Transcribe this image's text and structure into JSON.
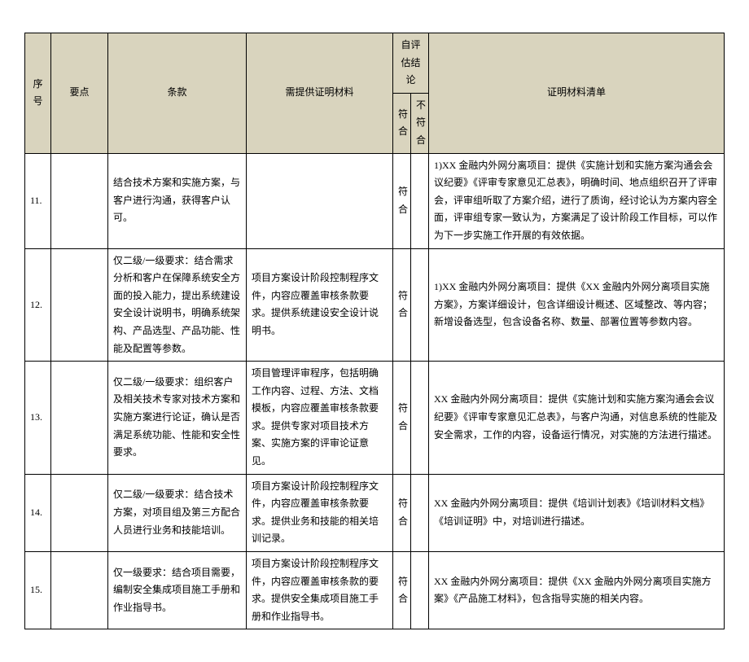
{
  "headers": {
    "no": "序号",
    "point": "要点",
    "clause": "条款",
    "material": "需提供证明材料",
    "self_eval": "自评估结论",
    "conform": "符合",
    "nonconform": "不符合",
    "list": "证明材料清单"
  },
  "rows": [
    {
      "no": "11.",
      "point": "",
      "clause": "结合技术方案和实施方案，与客户进行沟通，获得客户认可。",
      "material": "",
      "conform": "符合",
      "nonconform": "",
      "list": "1)XX 金融内外网分离项目：提供《实施计划和实施方案沟通会会议纪要》《评审专家意见汇总表》，明确时间、地点组织召开了评审会，评审组听取了方案介绍，进行了质询，经讨论认为方案内容全面，评审组专家一致认为，方案满足了设计阶段工作目标，可以作为下一步实施工作开展的有效依据。"
    },
    {
      "no": "12.",
      "point": "",
      "clause": "仅二级/一级要求：结合需求分析和客户在保障系统安全方面的投入能力，提出系统建设安全设计说明书，明确系统架构、产品选型、产品功能、性能及配置等参数。",
      "material": "项目方案设计阶段控制程序文件，内容应覆盖审核条款要求。提供系统建设安全设计说明书。",
      "conform": "符合",
      "nonconform": "",
      "list": "1)XX 金融内外网分离项目：提供《XX 金融内外网分离项目实施方案》，方案详细设计，包含详细设计概述、区域整改、等内容；新增设备选型，包含设备名称、数量、部署位置等参数内容。"
    },
    {
      "no": "13.",
      "point": "",
      "clause": "仅二级/一级要求：组织客户及相关技术专家对技术方案和实施方案进行论证，确认是否满足系统功能、性能和安全性要求。",
      "material": "项目管理评审程序，包括明确工作内容、过程、方法、文档模板，内容应覆盖审核条款要求。提供专家对项目技术方案、实施方案的评审论证意见。",
      "conform": "符合",
      "nonconform": "",
      "list": "XX 金融内外网分离项目：提供《实施计划和实施方案沟通会会议纪要》《评审专家意见汇总表》，与客户沟通，对信息系统的性能及安全需求，工作的内容，设备运行情况，对实施的方法进行描述。"
    },
    {
      "no": "14.",
      "point": "",
      "clause": "仅二级/一级要求：结合技术方案，对项目组及第三方配合人员进行业务和技能培训。",
      "material": "项目方案设计阶段控制程序文件，内容应覆盖审核条款要求。提供业务和技能的相关培训记录。",
      "conform": "符合",
      "nonconform": "",
      "list": "XX 金融内外网分离项目：提供《培训计划表》《培训材料文档》《培训证明》中，对培训进行描述。"
    },
    {
      "no": "15.",
      "point": "",
      "clause": "仅一级要求：结合项目需要，编制安全集成项目施工手册和作业指导书。",
      "material": "项目方案设计阶段控制程序文件，内容应覆盖审核条款的要求。提供安全集成项目施工手册和作业指导书。",
      "conform": "符合",
      "nonconform": "",
      "list": "XX 金融内外网分离项目：提供《XX 金融内外网分离项目实施方案》《产品施工材料》，包含指导实施的相关内容。"
    }
  ]
}
